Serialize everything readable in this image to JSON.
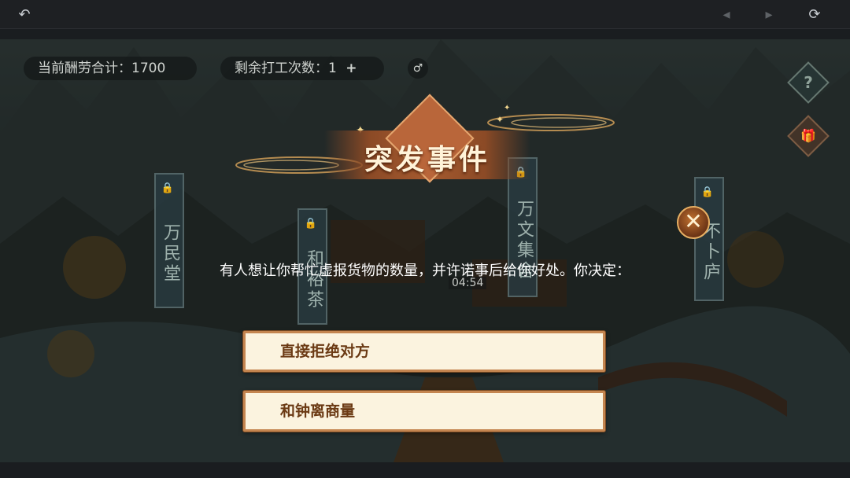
{
  "topbar": {
    "back_icon": "back-arrow-icon",
    "prev_icon": "diamond-left-icon",
    "next_icon": "diamond-right-icon",
    "refresh_icon": "refresh-icon"
  },
  "hud": {
    "earnings_text": "当前酬劳合计：1700",
    "work_text": "剩余打工次数：1",
    "plus_label": "+",
    "sound_icon": "♂"
  },
  "map": {
    "banners": [
      "万民堂",
      "和裕茶",
      "万文集舍",
      "不卜庐"
    ],
    "lock_icon": "🔒",
    "timer": "04:54",
    "help_label": "?",
    "gift_label": "🎁"
  },
  "event": {
    "title": "突发事件",
    "close_label": "✕",
    "question": "有人想让你帮忙虚报货物的数量，并许诺事后给你好处。你决定：",
    "options": [
      {
        "label": "直接拒绝对方"
      },
      {
        "label": "和钟离商量"
      }
    ]
  },
  "colors": {
    "accent": "#b9663a",
    "option_bg": "#fbf3df",
    "option_text": "#6b3a14"
  }
}
